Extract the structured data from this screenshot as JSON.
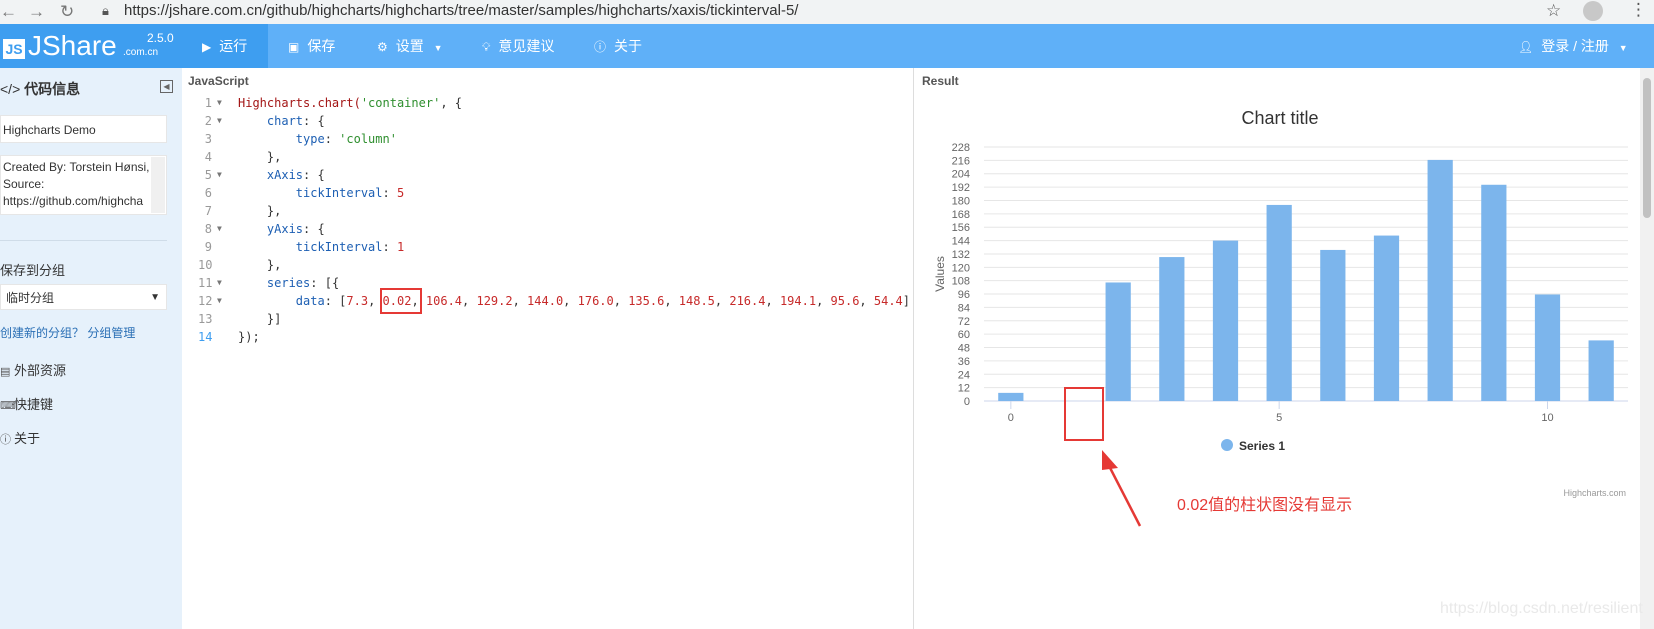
{
  "browser": {
    "url": "https://jshare.com.cn/github/highcharts/highcharts/tree/master/samples/highcharts/xaxis/tickinterval-5/"
  },
  "header": {
    "logo_js": "JS",
    "logo_name": "JShare",
    "logo_sub": ".com.cn",
    "version": "2.5.0",
    "buttons": {
      "run": "运行",
      "save": "保存",
      "settings": "设置",
      "feedback": "意见建议",
      "about": "关于"
    },
    "login": "登录 / 注册"
  },
  "sidebar": {
    "title": "代码信息",
    "demo_name": "Highcharts Demo",
    "description": "Created By: Torstein Hønsi, Source: https://github.com/highcha",
    "save_group_label": "保存到分组",
    "group_select": "临时分组",
    "create_group_link": "创建新的分组？",
    "manage_group_link": "分组管理",
    "items": {
      "external": "外部资源",
      "shortcuts": "快捷键",
      "about": "关于"
    }
  },
  "editor": {
    "label": "JavaScript",
    "lines": {
      "l1": [
        "Highcharts.chart(",
        "'container'",
        ", {"
      ],
      "l2": [
        "chart",
        ": {"
      ],
      "l3": [
        "type",
        ": ",
        "'column'"
      ],
      "l4": "},",
      "l5": [
        "xAxis",
        ": {"
      ],
      "l6": [
        "tickInterval",
        ": ",
        "5"
      ],
      "l7": "},",
      "l8": [
        "yAxis",
        ": {"
      ],
      "l9": [
        "tickInterval",
        ": ",
        "1"
      ],
      "l10": "},",
      "l11": [
        "series",
        ": [{"
      ],
      "l12": [
        "data",
        ": [",
        "7.3",
        ", ",
        "0.02",
        ", ",
        "106.4",
        ", ",
        "129.2",
        ", ",
        "144.0",
        ", ",
        "176.0",
        ", ",
        "135.6",
        ", ",
        "148.5",
        ", ",
        "216.4",
        ", ",
        "194.1",
        ", ",
        "95.6",
        ", ",
        "54.4",
        "]"
      ],
      "l13": "}]",
      "l14": "});"
    }
  },
  "result": {
    "label": "Result",
    "credits": "Highcharts.com"
  },
  "chart_data": {
    "type": "bar",
    "title": "Chart title",
    "ylabel": "Values",
    "xlabel": "",
    "x": [
      0,
      1,
      2,
      3,
      4,
      5,
      6,
      7,
      8,
      9,
      10,
      11
    ],
    "series": [
      {
        "name": "Series 1",
        "values": [
          7.3,
          0.02,
          106.4,
          129.2,
          144.0,
          176.0,
          135.6,
          148.5,
          216.4,
          194.1,
          95.6,
          54.4
        ]
      }
    ],
    "xticks": [
      0,
      5,
      10
    ],
    "yticks": [
      0,
      12,
      24,
      36,
      48,
      60,
      72,
      84,
      96,
      108,
      120,
      132,
      144,
      156,
      168,
      180,
      192,
      204,
      216,
      228
    ],
    "ylim": [
      0,
      228
    ],
    "color": "#7cb5ec",
    "grid": true,
    "legend": "bottom-center"
  },
  "annotation": {
    "text": "0.02值的柱状图没有显示",
    "color": "#e53935"
  },
  "watermark": "https://blog.csdn.net/resilient"
}
